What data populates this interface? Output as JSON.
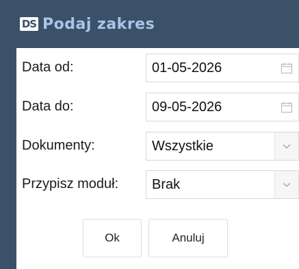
{
  "window": {
    "logo_text": "DS",
    "title": "Podaj zakres"
  },
  "form": {
    "rows": [
      {
        "label": "Data od:",
        "value": "01-05-2026",
        "icon": "calendar-icon"
      },
      {
        "label": "Data do:",
        "value": "09-05-2026",
        "icon": "calendar-icon"
      },
      {
        "label": "Dokumenty:",
        "value": "Wszystkie",
        "icon": "chevron-down-icon"
      },
      {
        "label": "Przypisz moduł:",
        "value": "Brak",
        "icon": "chevron-down-icon"
      }
    ]
  },
  "buttons": {
    "ok_label": "Ok",
    "cancel_label": "Anuluj"
  },
  "colors": {
    "titlebar_bg": "#3a5168",
    "title_text": "#a9c6e6"
  }
}
